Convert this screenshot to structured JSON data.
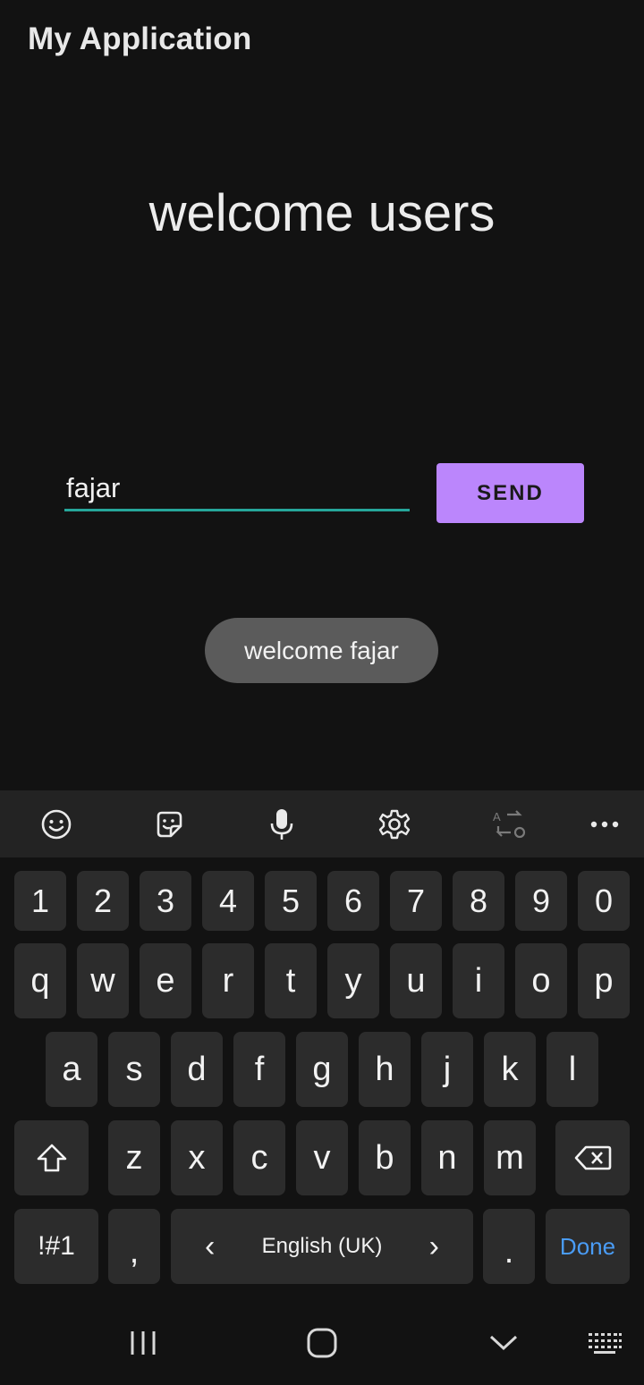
{
  "app": {
    "title": "My Application"
  },
  "main": {
    "heading": "welcome users",
    "name_input_value": "fajar",
    "send_label": "SEND",
    "toast_text": "welcome fajar"
  },
  "keyboard": {
    "toolbar_icons": [
      "emoji-icon",
      "sticker-icon",
      "microphone-icon",
      "settings-icon",
      "translate-icon",
      "more-icon"
    ],
    "number_row": [
      "1",
      "2",
      "3",
      "4",
      "5",
      "6",
      "7",
      "8",
      "9",
      "0"
    ],
    "row1": [
      "q",
      "w",
      "e",
      "r",
      "t",
      "y",
      "u",
      "i",
      "o",
      "p"
    ],
    "row2": [
      "a",
      "s",
      "d",
      "f",
      "g",
      "h",
      "j",
      "k",
      "l"
    ],
    "row3": [
      "z",
      "x",
      "c",
      "v",
      "b",
      "n",
      "m"
    ],
    "symbols_label": "!#1",
    "comma_label": ",",
    "language_label": "English (UK)",
    "lang_prev": "‹",
    "lang_next": "›",
    "period_label": ".",
    "done_label": "Done"
  },
  "colors": {
    "background": "#121212",
    "accent_teal": "#26a69a",
    "button_purple": "#bb86fc",
    "done_blue": "#4a9cf5"
  }
}
